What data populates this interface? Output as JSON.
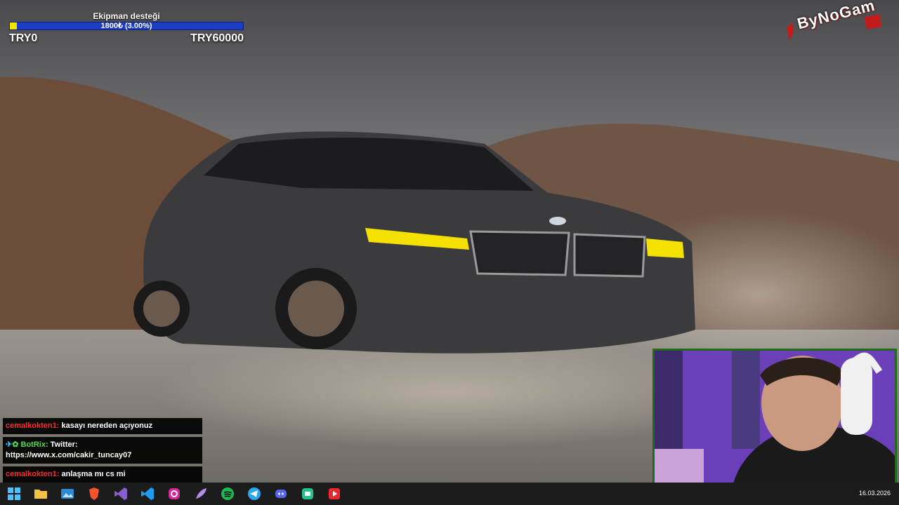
{
  "goal": {
    "title": "Ekipman desteği",
    "progress_label": "1800₺ (3.00%)",
    "progress_fraction": 0.03,
    "min_label": "TRY0",
    "max_label": "TRY60000",
    "fill_color": "#f2e600",
    "bar_color": "#1c3cc4"
  },
  "logo": {
    "text": "ByNoGam",
    "accent_color": "#c21b1b"
  },
  "chat": {
    "messages": [
      {
        "user": "cemalkokten1:",
        "text": "kasayı nereden açıyonuz",
        "bot": false
      },
      {
        "user": "BotRix:",
        "text": "Twitter: https://www.x.com/cakir_tuncay07",
        "bot": true
      },
      {
        "user": "cemalkokten1:",
        "text": "anlaşma mı cs mi",
        "bot": false
      }
    ]
  },
  "webcam": {
    "border_color": "#1f6b1a"
  },
  "taskbar": {
    "icons": [
      "windows-start-icon",
      "file-explorer-icon",
      "photos-icon",
      "brave-browser-icon",
      "visual-studio-icon",
      "vscode-icon",
      "instagram-icon",
      "feather-app-icon",
      "spotify-icon",
      "telegram-icon",
      "discord-icon",
      "chat-app-icon",
      "youtube-studio-icon"
    ],
    "date": "16.03.2026"
  }
}
